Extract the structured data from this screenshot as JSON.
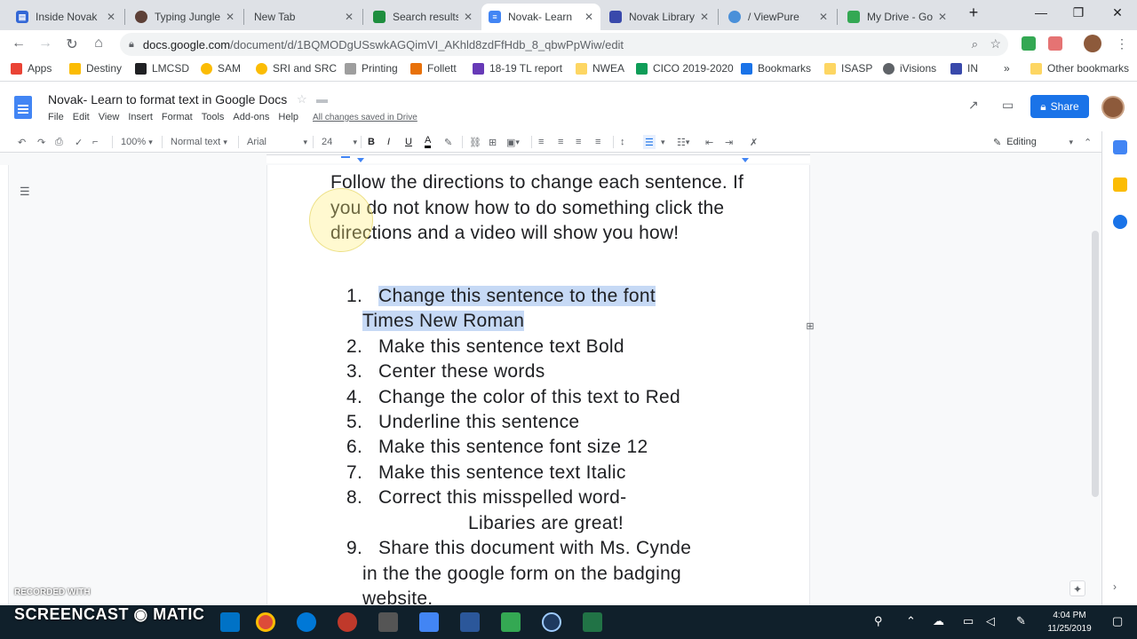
{
  "browser": {
    "tabs": [
      {
        "title": "Inside Novak",
        "color": "#3367d6",
        "glyph": "▤"
      },
      {
        "title": "Typing Jungle",
        "color": "#5d4037",
        "glyph": "●"
      },
      {
        "title": "New Tab",
        "color": "",
        "glyph": ""
      },
      {
        "title": "Search results",
        "color": "#1e8e3e",
        "glyph": "▲"
      },
      {
        "title": "Novak- Learn",
        "color": "#4285f4",
        "glyph": "▤"
      },
      {
        "title": "Novak Library",
        "color": "#3949ab",
        "glyph": "▦"
      },
      {
        "title": "/ ViewPure",
        "color": "#4a90d9",
        "glyph": "✱"
      },
      {
        "title": "My Drive - Go",
        "color": "#34a853",
        "glyph": "▲"
      }
    ],
    "new_tab": "+",
    "window_controls": {
      "minimize": "—",
      "maximize": "❐",
      "close": "✕"
    },
    "url_host": "docs.google.com",
    "url_path": "/document/d/1BQMODgUSswkAGQimVI_AKhld8zdFfHdb_8_qbwPpWiw/edit",
    "bookmarks": [
      {
        "label": "Apps",
        "color": "#ea4335"
      },
      {
        "label": "Destiny",
        "color": "#fbbc04"
      },
      {
        "label": "LMCSD",
        "color": "#202124"
      },
      {
        "label": "SAM",
        "color": "#fbbc04"
      },
      {
        "label": "SRI and SRC",
        "color": "#fbbc04"
      },
      {
        "label": "Printing",
        "color": "#9e9e9e"
      },
      {
        "label": "Follett",
        "color": "#e8710a"
      },
      {
        "label": "18-19 TL report",
        "color": "#673ab7"
      },
      {
        "label": "NWEA",
        "color": "#fdd663"
      },
      {
        "label": "CICO 2019-2020",
        "color": "#0f9d58"
      },
      {
        "label": "Bookmarks",
        "color": "#1a73e8"
      },
      {
        "label": "ISASP",
        "color": "#fdd663"
      },
      {
        "label": "iVisions",
        "color": "#5f6368"
      },
      {
        "label": "IN",
        "color": "#3949ab"
      }
    ],
    "more_bookmarks": "»",
    "other_bookmarks": "Other bookmarks"
  },
  "docs": {
    "title": "Novak- Learn to format text in Google Docs",
    "menus": [
      "File",
      "Edit",
      "View",
      "Insert",
      "Format",
      "Tools",
      "Add-ons",
      "Help"
    ],
    "save_status": "All changes saved in Drive",
    "share_label": "Share",
    "toolbar": {
      "zoom": "100%",
      "style": "Normal text",
      "font": "Arial",
      "size": "24",
      "mode": "Editing"
    }
  },
  "document": {
    "intro": "Follow the directions to change each sentence.  If you do not know how to do something click the directions and a video will show you how!",
    "items": [
      {
        "num": "1.",
        "text": "Change this sentence to the font",
        "cont": "Times New Roman"
      },
      {
        "num": "2.",
        "text": "Make this sentence text Bold"
      },
      {
        "num": "3.",
        "text": "Center these words"
      },
      {
        "num": "4.",
        "text": "Change the color of this text to Red"
      },
      {
        "num": "5.",
        "text": "Underline this sentence"
      },
      {
        "num": "6.",
        "text": "Make this sentence font size 12"
      },
      {
        "num": "7.",
        "text": "Make this sentence text Italic"
      },
      {
        "num": "8.",
        "text": "Correct this misspelled word-",
        "cont": "Libaries are great!"
      },
      {
        "num": "9.",
        "text": "Share this document with Ms. Cynde",
        "cont": "in the the google form on the badging",
        "cont2": "website."
      }
    ]
  },
  "taskbar": {
    "recorded_with": "RECORDED WITH",
    "brand": "SCREENCAST ◉ MATIC",
    "time": "4:04 PM",
    "date": "11/25/2019"
  }
}
